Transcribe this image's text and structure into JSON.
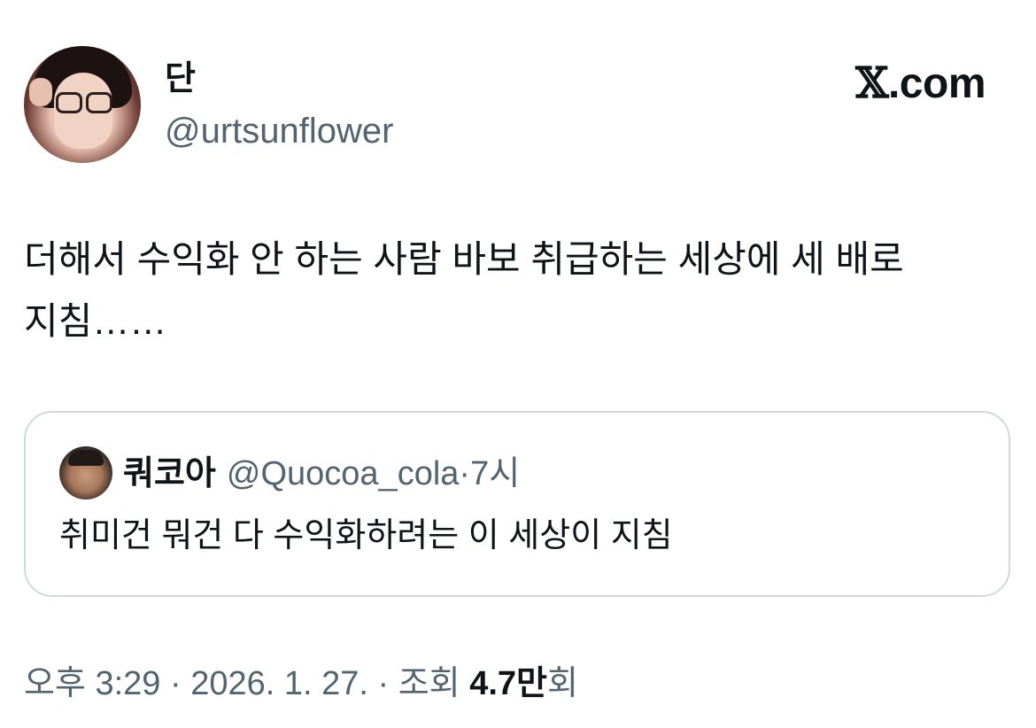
{
  "author": {
    "display_name": "단",
    "handle": "@urtsunflower"
  },
  "brand": {
    "mark": "𝕏",
    "suffix": ".com"
  },
  "tweet": {
    "text": "더해서 수익화 안 하는 사람 바보 취급하는 세상에 세 배로 지침……"
  },
  "quoted_tweet": {
    "display_name": "쿼코아",
    "handle": "@Quocoa_cola",
    "separator": "·",
    "time": "7시",
    "text": "취미건 뭐건 다 수익화하려는 이 세상이 지침"
  },
  "footer": {
    "timestamp": "오후 3:29 · 2026. 1. 27. · 조회",
    "views_count": "4.7만",
    "views_suffix": "회"
  },
  "colors": {
    "text_primary": "#0f1419",
    "text_secondary": "#536471",
    "border": "#cfd9de",
    "background": "#ffffff"
  }
}
